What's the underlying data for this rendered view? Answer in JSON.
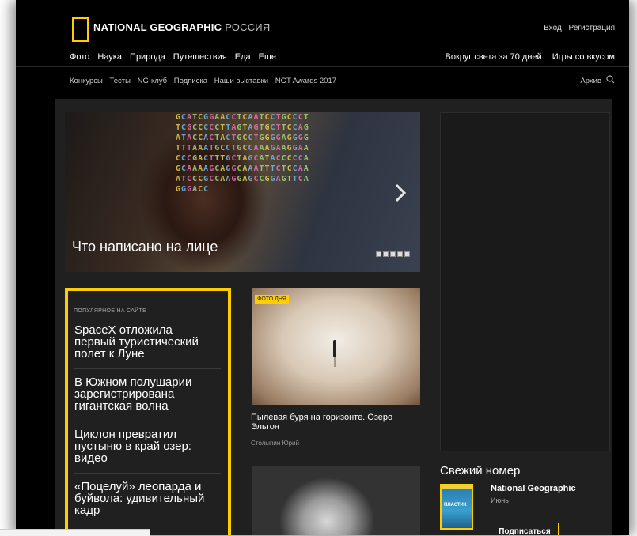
{
  "header": {
    "logo_main": "NATIONAL GEOGRAPHIC",
    "logo_region": "РОССИЯ",
    "login": "Вход",
    "register": "Регистрация"
  },
  "nav_primary": [
    "Фото",
    "Наука",
    "Природа",
    "Путешествия",
    "Еда",
    "Еще"
  ],
  "nav_primary_right": [
    "Вокруг света за 70 дней",
    "Игры со вкусом"
  ],
  "nav_secondary": [
    "Конкурсы",
    "Тесты",
    "NG-клуб",
    "Подписка",
    "Наши выставки",
    "NGT Awards 2017"
  ],
  "nav_secondary_right": {
    "archive": "Архив",
    "search_icon": "search-icon"
  },
  "hero": {
    "title": "Что написано на лице",
    "next_icon": "chevron-right-icon",
    "slides_count": 5,
    "dna_text": "GCATCGGAACCTCAATCCTGCCCTTCGCCCCCTTAGTAGTGCTTCCAGATACCACTACTGCCTGGGGAGGGGTTTAAATGCCTGCCAAAGAAGGAACCCGACTTTGCTAGCATACCCCCAGCAAAAGCAGGCAAATTTCTCCAAATCCCGCCAAGGAGCCGGAGTTCAGGGACC"
  },
  "popular": {
    "label": "ПОПУЛЯРНОЕ НА САЙТЕ",
    "items": [
      "SpaceX отложила первый туристический полет к Луне",
      "В Южном полушарии зарегистрирована гигантская волна",
      "Циклон превратил пустыню в край озер: видео",
      "«Поцелуй» леопарда и буйвола: удивительный кадр"
    ]
  },
  "photo_of_day": {
    "badge": "ФОТО ДНЯ",
    "title": "Пылевая буря на горизонте. Озеро Эльтон",
    "author": "Столыпин Юрий"
  },
  "fresh_issue": {
    "heading": "Свежий номер",
    "cover_text": "ПЛАСТИК",
    "magazine": "National Geographic",
    "month": "Июнь",
    "subscribe": "Подписаться"
  },
  "colors": {
    "accent": "#ffce00",
    "background": "#000000",
    "panel": "#202020"
  }
}
